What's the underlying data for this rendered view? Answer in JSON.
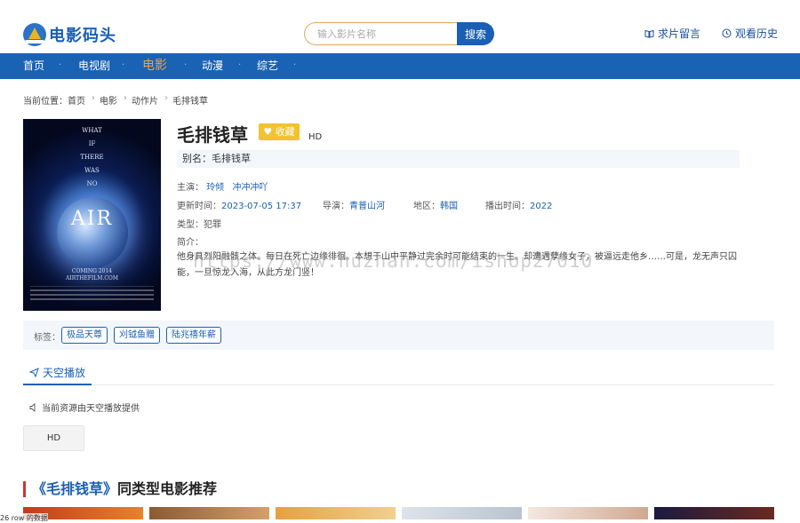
{
  "header": {
    "logo_text": "电影码头",
    "search_placeholder": "输入影片名称",
    "search_button": "搜索",
    "request_link": "求片留言",
    "history_link": "观看历史"
  },
  "nav": {
    "items": [
      {
        "label": "首页"
      },
      {
        "label": "电视剧"
      },
      {
        "label": "电影"
      },
      {
        "label": "动漫"
      },
      {
        "label": "综艺"
      }
    ],
    "separator": "·"
  },
  "breadcrumb": {
    "prefix": "当前位置：",
    "items": [
      "首页",
      "电影",
      "动作片",
      "毛排钱草"
    ],
    "sep": "›"
  },
  "poster": {
    "words": [
      "WHAT",
      "IF",
      "THERE",
      "WAS",
      "NO"
    ],
    "title": "AIR",
    "coming": "COMING 2014",
    "site": "AIRTHEFILM.COM"
  },
  "movie": {
    "title": "毛排钱草",
    "favorite": "收藏",
    "quality": "HD",
    "alias_label": "别名：",
    "alias": "毛排钱草",
    "cast_label": "主演：",
    "cast": [
      "玲倾",
      "冲冲冲吖"
    ],
    "updated_label": "更新时间：",
    "updated": "2023-07-05 17:37",
    "director_label": "导演：",
    "director": "青普山河",
    "region_label": "地区：",
    "region": "韩国",
    "year_label": "播出时间：",
    "year": "2022",
    "genre_label": "类型：",
    "genre": "犯罪",
    "intro_label": "简介：",
    "description": "他身具烈阳融骸之体。每日在死亡边缘徘徊。本想于山中平静过完余时可能结束的一生。却遭遇孽缘女子，被逼远走他乡……可是，龙无声只囚能，一旦惊龙入海，从此方龙门竖！"
  },
  "watermark": "https://www.huzhan.com/ishop27010",
  "tags": {
    "label": "标签：",
    "items": [
      "极品天尊",
      "刈钺鱼赠",
      "陆兆禧年薪"
    ]
  },
  "play": {
    "tab_label": "天空播放",
    "note": "当前资源由天空播放提供",
    "episode": "HD"
  },
  "recommend": {
    "title_prefix": "《毛排钱草》",
    "title_suffix": "同类型电影推荐"
  },
  "stray_text": "26 row 的数据",
  "colors": {
    "brand_blue": "#1a63b4",
    "accent_orange": "#f0a23a",
    "favorite_yellow": "#f2c230",
    "section_red": "#d9302c"
  }
}
